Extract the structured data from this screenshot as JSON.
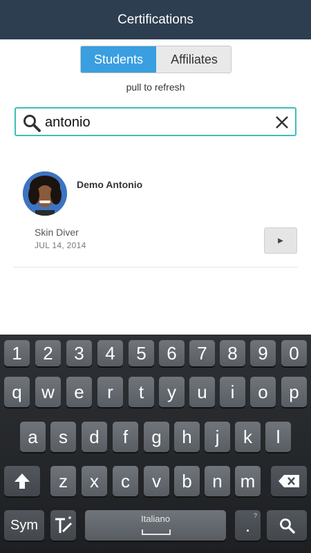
{
  "header": {
    "title": "Certifications"
  },
  "tabs": [
    {
      "label": "Students",
      "active": true
    },
    {
      "label": "Affiliates",
      "active": false
    }
  ],
  "refresh_hint": "pull to refresh",
  "search": {
    "value": "antonio"
  },
  "results": [
    {
      "name": "Demo Antonio",
      "certification": "Skin Diver",
      "date": "JUL 14, 2014",
      "action_icon": "play-icon"
    }
  ],
  "keyboard": {
    "row1": [
      "1",
      "2",
      "3",
      "4",
      "5",
      "6",
      "7",
      "8",
      "9",
      "0"
    ],
    "row2": [
      "q",
      "w",
      "e",
      "r",
      "t",
      "y",
      "u",
      "i",
      "o",
      "p"
    ],
    "row3": [
      "a",
      "s",
      "d",
      "f",
      "g",
      "h",
      "j",
      "k",
      "l"
    ],
    "row4": [
      "z",
      "x",
      "c",
      "v",
      "b",
      "n",
      "m"
    ],
    "sym_label": "Sym",
    "space_label": "Italiano",
    "period_label": "."
  },
  "colors": {
    "header_bg": "#2d3e50",
    "active_tab": "#3a9fe0",
    "search_border": "#3cc0b6"
  }
}
